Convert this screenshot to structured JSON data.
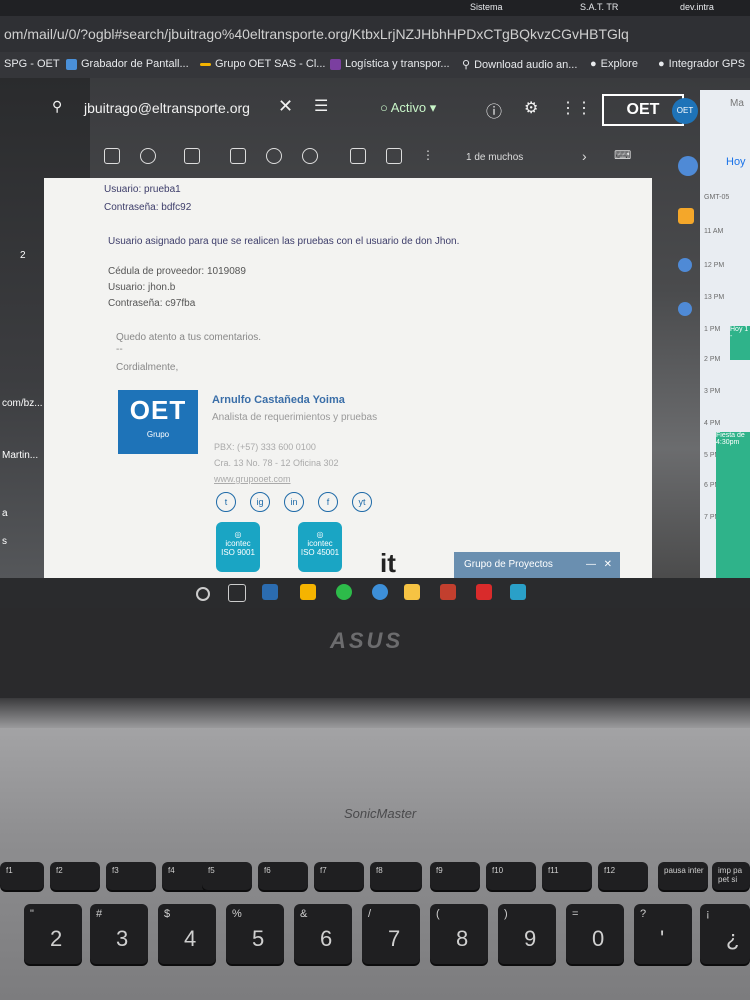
{
  "browser": {
    "tabs": [
      "Sistema",
      "S.A.T. TR",
      "dev.intra"
    ],
    "url": "om/mail/u/0/?ogbl#search/jbuitrago%40eltransporte.org/KtbxLrjNZJHbhHPDxCTgBQkvzCGvHBTGlq",
    "bookmarks": [
      {
        "label": "SPG - OET",
        "color": "#1a73e8"
      },
      {
        "label": "Grabador de Pantall...",
        "color": "#4a90d9"
      },
      {
        "label": "Grupo OET SAS - Cl...",
        "color": "#f4b400"
      },
      {
        "label": "Logística y transpor...",
        "color": "#7b3fa0"
      },
      {
        "label": "Download audio an...",
        "color": "#dddddd"
      },
      {
        "label": "Explore",
        "color": "#cccccc"
      },
      {
        "label": "Integrador GPS",
        "color": "#cccccc"
      }
    ]
  },
  "gmail": {
    "search_value": "jbuitrago@eltransporte.org",
    "status": "Activo",
    "logo": "OET",
    "pager": "1 de muchos",
    "left_labels": [
      "2",
      "com/bz...",
      "Martin...",
      "a",
      "s"
    ]
  },
  "email": {
    "lines": [
      {
        "label": "Usuario:",
        "value": "prueba1"
      },
      {
        "label": "Contraseña:",
        "value": "bdfc92"
      }
    ],
    "note": "Usuario asignado para que se realicen las pruebas con el usuario de don Jhon.",
    "provider": [
      {
        "label": "Cédula de proveedor:",
        "value": "1019089"
      },
      {
        "label": "Usuario:",
        "value": "jhon.b"
      },
      {
        "label": "Contraseña:",
        "value": "c97fba"
      }
    ],
    "closing": "Quedo atento a tus comentarios.",
    "separator": "--",
    "cordially": "Cordialmente,",
    "signature": {
      "name": "Arnulfo Castañeda Yoima",
      "role": "Analista de requerimientos y pruebas",
      "logo_big": "OET",
      "logo_small": "Grupo",
      "pbx": "PBX: (+57) 333 600 0100",
      "address": "Cra. 13 No. 78 - 12 Oficina 302",
      "web": "www.grupooet.com"
    },
    "social": [
      "t",
      "ig",
      "in",
      "f",
      "yt"
    ],
    "badges": [
      {
        "top": "icontec",
        "bottom": "ISO 9001"
      },
      {
        "top": "icontec",
        "bottom": "ISO 45001"
      }
    ],
    "brand_tag": "it",
    "popup": "Grupo de Proyectos"
  },
  "calendar": {
    "header_day": "Hoy",
    "header_month": "Ma",
    "times": [
      "GMT-05",
      "11 AM",
      "12 PM",
      "13 PM",
      "1 PM",
      "2 PM",
      "3 PM",
      "4 PM",
      "5 PM",
      "6 PM",
      "7 PM"
    ],
    "event1": "Hoy 1 -",
    "event2": "Fiesta de 4:30pm"
  },
  "laptop": {
    "brand": "ASUS",
    "speaker": "SonicMaster",
    "fkeys": [
      "f1",
      "f2",
      "f3",
      "f4",
      "f5",
      "f6",
      "f7",
      "f8",
      "f9",
      "f10",
      "f11",
      "f12",
      "pausa inter",
      "imp pa pet si"
    ],
    "numkeys": [
      {
        "shift": "\"",
        "main": "2"
      },
      {
        "shift": "#",
        "main": "3"
      },
      {
        "shift": "$",
        "main": "4"
      },
      {
        "shift": "%",
        "main": "5"
      },
      {
        "shift": "&",
        "main": "6"
      },
      {
        "shift": "/",
        "main": "7"
      },
      {
        "shift": "(",
        "main": "8"
      },
      {
        "shift": ")",
        "main": "9"
      },
      {
        "shift": "=",
        "main": "0"
      },
      {
        "shift": "?",
        "main": "'"
      },
      {
        "shift": "¡",
        "main": "¿"
      }
    ]
  }
}
